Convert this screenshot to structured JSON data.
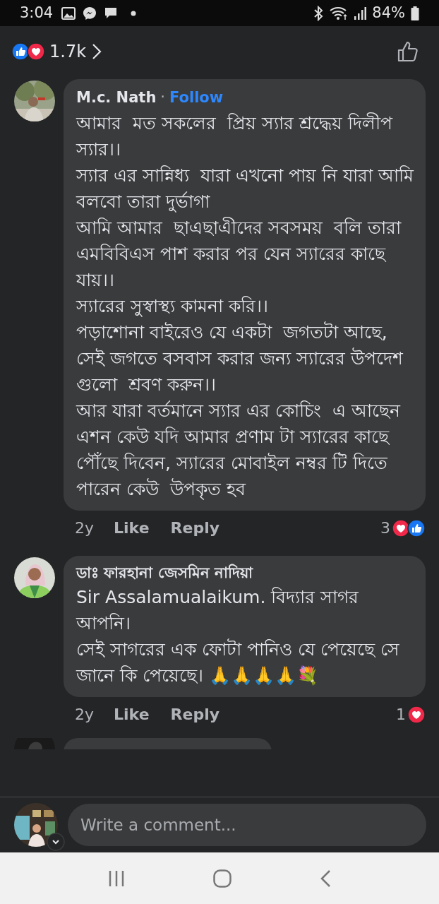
{
  "status_bar": {
    "time": "3:04",
    "battery": "84%"
  },
  "post_reactions": {
    "count": "1.7k",
    "kinds": [
      {
        "kind": "like"
      },
      {
        "kind": "love"
      }
    ]
  },
  "comments": [
    {
      "author": "M.c. Nath",
      "separator": "·",
      "follow": "Follow",
      "text": "আমার  মত সকলের  প্রিয় স্যার শ্রদ্ধেয় দিলীপ স্যার।।\nস্যার এর সান্নিধ্য  যারা এখনো পায় নি যারা আমি বলবো তারা দুর্ভাগা\nআমি আমার  ছাএছাএীদের সবসময়  বলি তারা এমবিবিএস পাশ করার পর যেন স্যারের কাছে  যায়।।\nস্যারের সুস্বাস্থ্য কামনা করি।।\nপড়াশোনা বাইরেও যে একটা  জগতটা আছে, সেই জগতে বসবাস করার জন্য স্যারের উপদেশ গুলো  শ্রবণ করুন।।\nআর যারা বর্তমানে স্যার এর কোচিং  এ আছেন এশন কেউ যদি আমার প্রণাম টা স্যারের কাছে  পৌঁছে দিবেন, স্যারের মোবাইল নম্বর টি দিতে পারেন কেউ  উপকৃত হব",
      "age": "2y",
      "like": "Like",
      "reply": "Reply",
      "reaction_count": "3",
      "reaction_kinds": [
        {
          "kind": "love"
        },
        {
          "kind": "like"
        }
      ]
    },
    {
      "author": "ডাঃ ফারহানা জেসমিন নাদিয়া",
      "text": "Sir Assalamualaikum. বিদ্যার সাগর আপনি।\nসেই সাগরের এক ফোটা পানিও যে পেয়েছে সে\nজানে কি পেয়েছে। 🙏🙏🙏🙏💐",
      "age": "2y",
      "like": "Like",
      "reply": "Reply",
      "reaction_count": "1",
      "reaction_kinds": [
        {
          "kind": "love"
        }
      ]
    }
  ],
  "composer": {
    "placeholder": "Write a comment..."
  }
}
